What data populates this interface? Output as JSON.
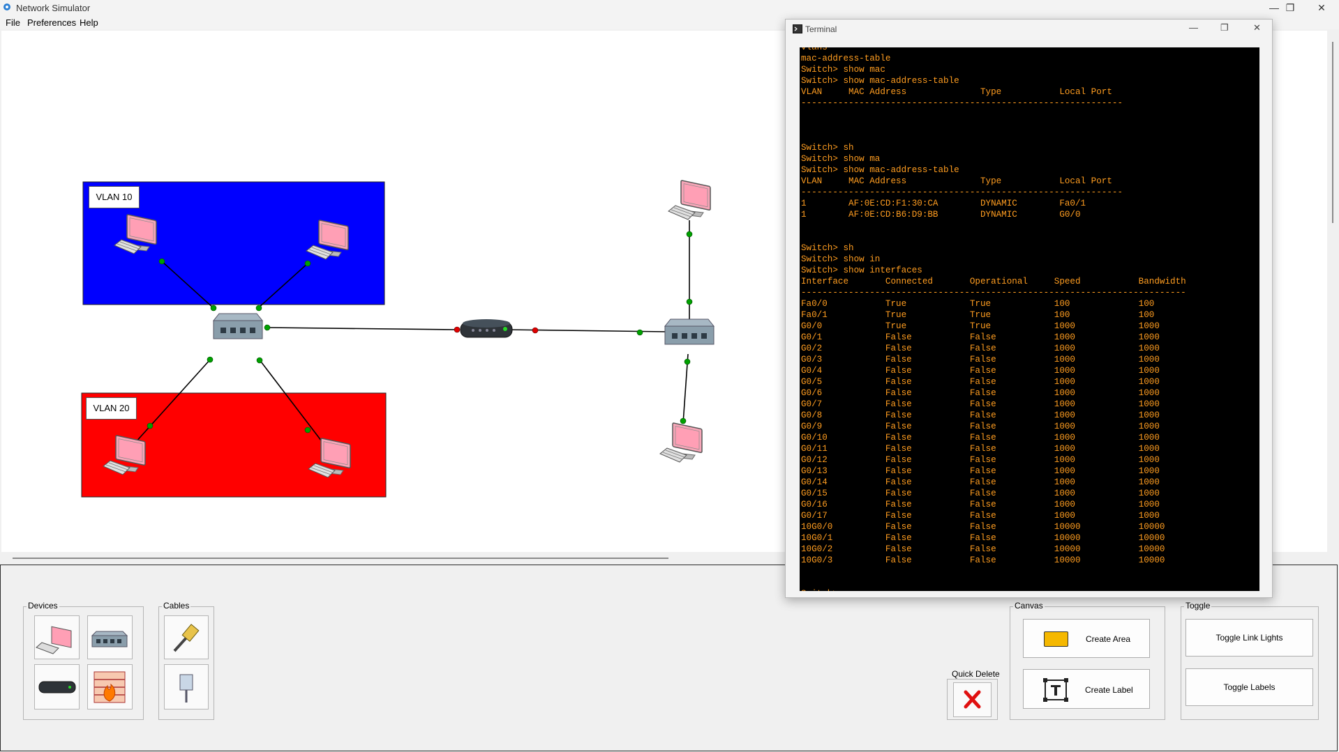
{
  "app": {
    "title": "Network Simulator"
  },
  "menu": {
    "file": "File",
    "preferences": "Preferences",
    "help": "Help"
  },
  "window_controls": {
    "minimize": "—",
    "maximize": "❐",
    "close": "✕"
  },
  "canvas": {
    "vlan10": {
      "label": "VLAN 10",
      "color": "#0000ff"
    },
    "vlan20": {
      "label": "VLAN 20",
      "color": "#ff0000"
    }
  },
  "link_colors": {
    "up": "#00aa00",
    "down": "#dd0000"
  },
  "terminal": {
    "title": "Terminal",
    "lines": [
      "vlans",
      "mac-address-table",
      "Switch> show mac",
      "Switch> show mac-address-table",
      "VLAN     MAC Address              Type           Local Port",
      "-------------------------------------------------------------",
      "",
      "",
      "",
      "Switch> sh",
      "Switch> show ma",
      "Switch> show mac-address-table",
      "VLAN     MAC Address              Type           Local Port",
      "-------------------------------------------------------------",
      "1        AF:0E:CD:F1:30:CA        DYNAMIC        Fa0/1",
      "1        AF:0E:CD:B6:D9:BB        DYNAMIC        G0/0",
      "",
      "",
      "Switch> sh",
      "Switch> show in",
      "Switch> show interfaces",
      "Interface       Connected       Operational     Speed           Bandwidth",
      "-------------------------------------------------------------------------",
      "Fa0/0           True            True            100             100",
      "Fa0/1           True            True            100             100",
      "G0/0            True            True            1000            1000",
      "G0/1            False           False           1000            1000",
      "G0/2            False           False           1000            1000",
      "G0/3            False           False           1000            1000",
      "G0/4            False           False           1000            1000",
      "G0/5            False           False           1000            1000",
      "G0/6            False           False           1000            1000",
      "G0/7            False           False           1000            1000",
      "G0/8            False           False           1000            1000",
      "G0/9            False           False           1000            1000",
      "G0/10           False           False           1000            1000",
      "G0/11           False           False           1000            1000",
      "G0/12           False           False           1000            1000",
      "G0/13           False           False           1000            1000",
      "G0/14           False           False           1000            1000",
      "G0/15           False           False           1000            1000",
      "G0/16           False           False           1000            1000",
      "G0/17           False           False           1000            1000",
      "10G0/0          False           False           10000           10000",
      "10G0/1          False           False           10000           10000",
      "10G0/2          False           False           10000           10000",
      "10G0/3          False           False           10000           10000",
      "",
      "",
      "Switch>"
    ]
  },
  "panels": {
    "devices": {
      "label": "Devices"
    },
    "cables": {
      "label": "Cables"
    },
    "quick_delete": {
      "label": "Quick Delete"
    },
    "canvas": {
      "label": "Canvas",
      "create_area": "Create Area",
      "create_label": "Create Label",
      "area_color": "#f5b800"
    },
    "toggle": {
      "label": "Toggle",
      "link_lights": "Toggle Link Lights",
      "labels": "Toggle Labels"
    }
  }
}
